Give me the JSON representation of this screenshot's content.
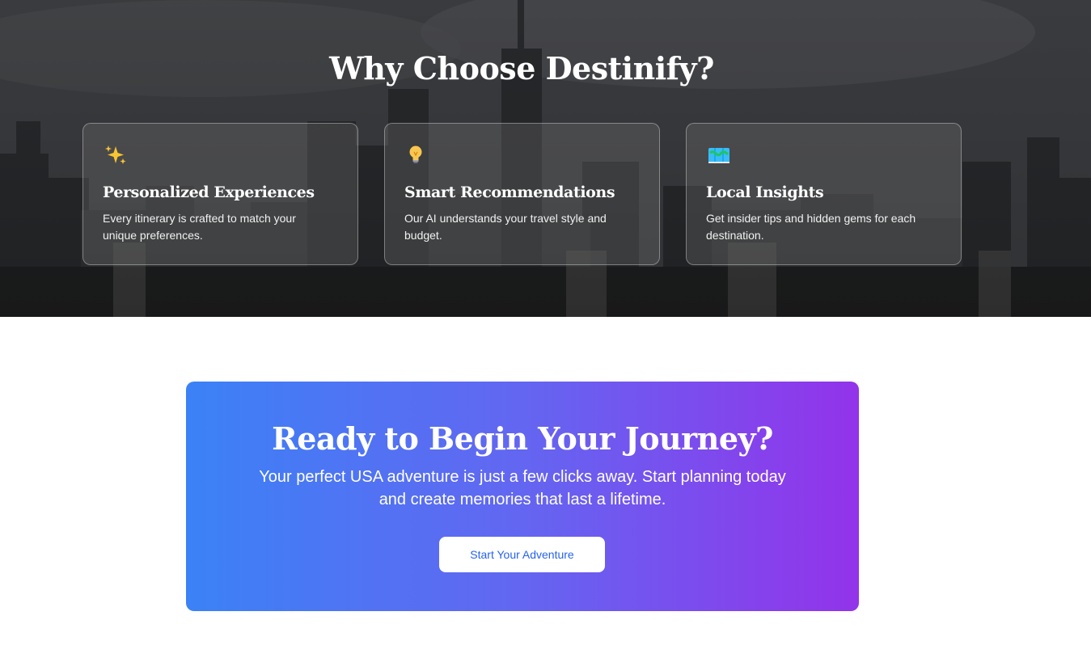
{
  "features": {
    "title": "Why Choose Destinify?",
    "cards": [
      {
        "icon": "sparkles-icon",
        "title": "Personalized Experiences",
        "text": "Every itinerary is crafted to match your unique preferences."
      },
      {
        "icon": "light-bulb-icon",
        "title": "Smart Recommendations",
        "text": "Our AI understands your travel style and budget."
      },
      {
        "icon": "map-icon",
        "title": "Local Insights",
        "text": "Get insider tips and hidden gems for each destination."
      }
    ]
  },
  "cta": {
    "title": "Ready to Begin Your Journey?",
    "text": "Your perfect USA adventure is just a few clicks away. Start planning today and create memories that last a lifetime.",
    "button_label": "Start Your Adventure"
  },
  "colors": {
    "cta_gradient_start": "#3b82f6",
    "cta_gradient_mid": "#6366f1",
    "cta_gradient_end": "#9333ea",
    "button_text": "#2563eb"
  }
}
